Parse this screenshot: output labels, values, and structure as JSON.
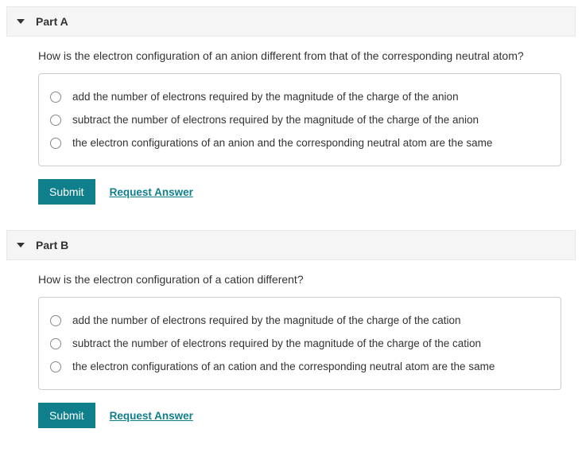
{
  "parts": [
    {
      "title": "Part A",
      "question": "How is the electron configuration of an anion different from that of the corresponding neutral atom?",
      "options": [
        "add the number of electrons required by the magnitude of the charge of the anion",
        "subtract the number of electrons required by the magnitude of the charge of the anion",
        "the electron configurations of an anion and the corresponding neutral atom are the same"
      ],
      "submit_label": "Submit",
      "request_label": "Request Answer"
    },
    {
      "title": "Part B",
      "question": "How is the electron configuration of a cation different?",
      "options": [
        "add the number of electrons required by the magnitude of the charge of the cation",
        "subtract the number of electrons required by the magnitude of the charge of the cation",
        "the electron configurations of an cation and the corresponding neutral atom are the same"
      ],
      "submit_label": "Submit",
      "request_label": "Request Answer"
    }
  ]
}
